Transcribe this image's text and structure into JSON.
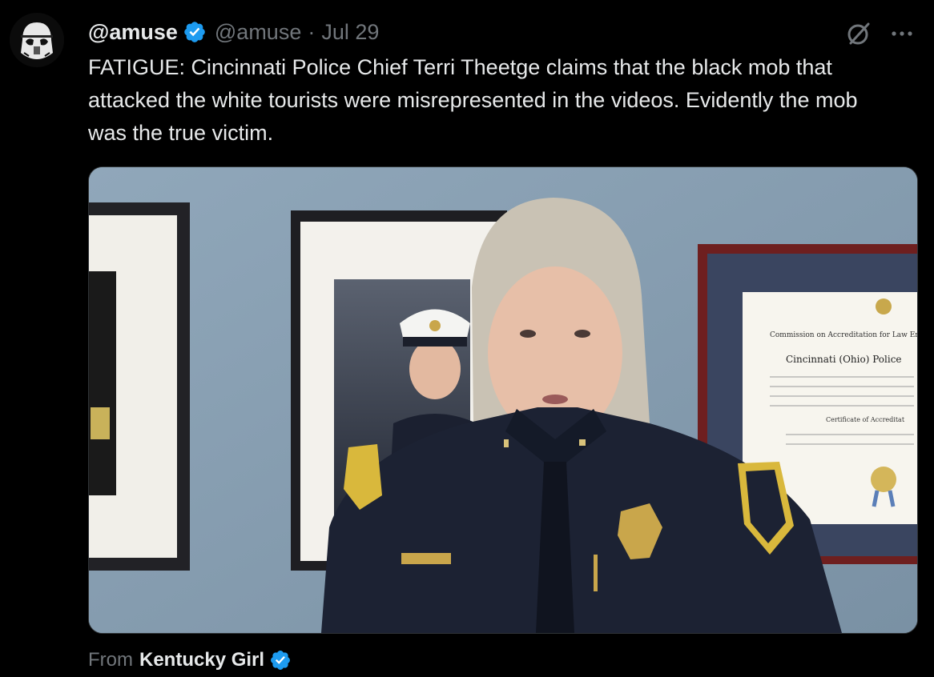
{
  "author": {
    "display_name": "@amuse",
    "handle": "@amuse",
    "separator": "·",
    "date": "Jul 29",
    "avatar_icon": "stormtrooper-helmet-icon",
    "verified_color": "#1d9bf0"
  },
  "tweet": {
    "text": "FATIGUE: Cincinnati Police Chief Terri Theetge claims that the black mob that attacked the white tourists were misrepresented in the videos. Evidently the mob was the true victim."
  },
  "actions": {
    "grok_icon": "grok-icon",
    "more_icon": "more-icon"
  },
  "media": {
    "certificate_line1": "Commission on Accreditation for Law Enf",
    "certificate_line2": "Cincinnati (Ohio) Police",
    "certificate_line3": "Certificate of Accreditat"
  },
  "attribution": {
    "from_label": "From",
    "source_name": "Kentucky Girl"
  },
  "colors": {
    "background": "#000000",
    "text_primary": "#e7e9ea",
    "text_secondary": "#71767b",
    "wall": "#8aa1b4",
    "uniform": "#1c2233"
  }
}
